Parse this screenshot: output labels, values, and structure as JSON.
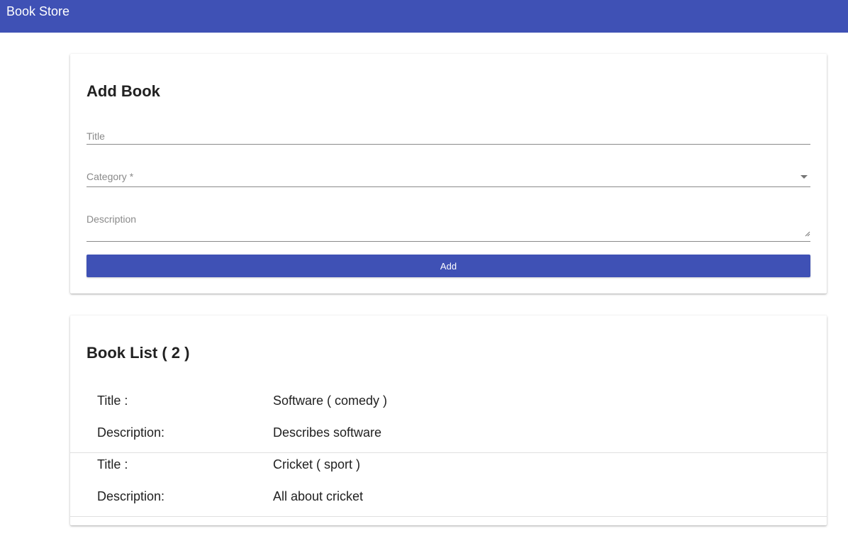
{
  "app": {
    "title": "Book Store"
  },
  "add_book": {
    "heading": "Add Book",
    "title_placeholder": "Title",
    "category_placeholder": "Category *",
    "description_placeholder": "Description",
    "add_label": "Add"
  },
  "book_list": {
    "heading": "Book List ( 2 )",
    "items": [
      {
        "title_label": "Title :",
        "title_value": "Software ( comedy )",
        "description_label": "Description:",
        "description_value": "Describes software"
      },
      {
        "title_label": "Title :",
        "title_value": "Cricket ( sport )",
        "description_label": "Description:",
        "description_value": "All about cricket"
      }
    ]
  },
  "colors": {
    "primary": "#3f51b5",
    "divider": "#e0e0e0",
    "text": "#212121",
    "hint": "#8a8a8a"
  }
}
